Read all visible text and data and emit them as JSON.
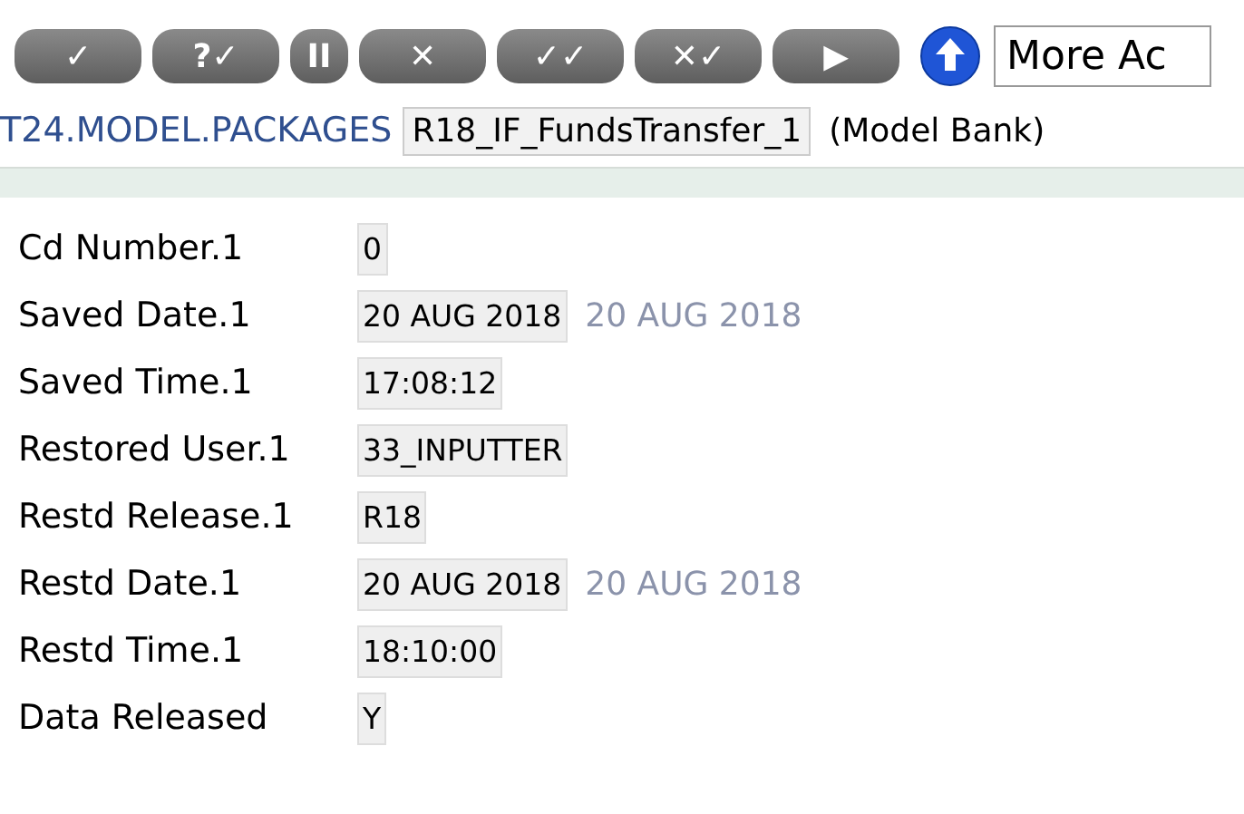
{
  "toolbar": {
    "buttons": [
      {
        "glyph": "✓",
        "kind": "wide"
      },
      {
        "glyph": "?✓",
        "kind": "wide"
      },
      {
        "glyph": "II",
        "kind": "narrow"
      },
      {
        "glyph": "✕",
        "kind": "wide"
      },
      {
        "glyph": "✓✓",
        "kind": "wide"
      },
      {
        "glyph": "✕✓",
        "kind": "wide"
      },
      {
        "glyph": "▶",
        "kind": "wide"
      }
    ],
    "more_actions": {
      "value": "More Ac"
    }
  },
  "header": {
    "application": "T24.MODEL.PACKAGES",
    "record_id": "R18_IF_FundsTransfer_1",
    "company": "(Model Bank)"
  },
  "fields": [
    {
      "label": "Cd Number.1",
      "value": "0"
    },
    {
      "label": "Saved Date.1",
      "value": "20 AUG 2018",
      "enrichment": "20 AUG 2018"
    },
    {
      "label": "Saved Time.1",
      "value": "17:08:12"
    },
    {
      "label": "Restored User.1",
      "value": "33_INPUTTER"
    },
    {
      "label": "Restd Release.1",
      "value": "R18"
    },
    {
      "label": "Restd Date.1",
      "value": "20 AUG 2018",
      "enrichment": "20 AUG 2018"
    },
    {
      "label": "Restd Time.1",
      "value": "18:10:00"
    },
    {
      "label": "Data Released",
      "value": "Y"
    }
  ]
}
